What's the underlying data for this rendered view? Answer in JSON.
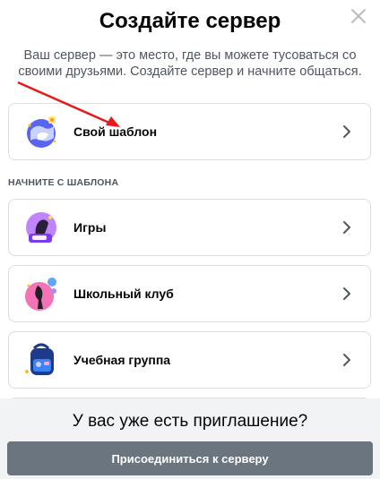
{
  "modal": {
    "title": "Создайте сервер",
    "subtitle": "Ваш сервер — это место, где вы можете тусоваться со своими друзьями. Создайте сервер и начните общаться."
  },
  "create_own": {
    "label": "Свой шаблон"
  },
  "templates_section": {
    "label": "НАЧНИТЕ С ШАБЛОНА",
    "items": [
      {
        "label": "Игры"
      },
      {
        "label": "Школьный клуб"
      },
      {
        "label": "Учебная группа"
      }
    ]
  },
  "footer": {
    "question": "У вас уже есть приглашение?",
    "join_label": "Присоединиться к серверу"
  },
  "colors": {
    "annotation_arrow": "#e8191b",
    "join_button": "#6b7580",
    "footer_bg": "#f2f3f5"
  },
  "icons": [
    "close-icon",
    "chevron-right-icon"
  ]
}
